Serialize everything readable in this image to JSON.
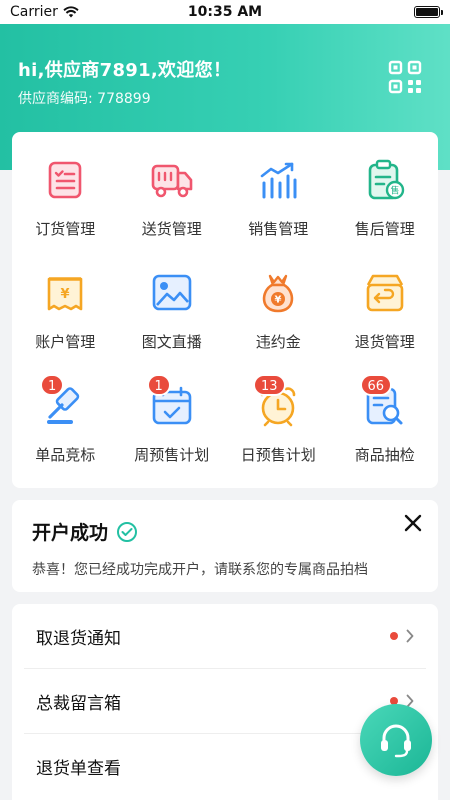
{
  "status_bar": {
    "carrier": "Carrier",
    "time": "10:35 AM"
  },
  "header": {
    "greeting": "hi,供应商7891,欢迎您！",
    "supplier_code": "供应商编码: 778899"
  },
  "menu": [
    {
      "label": "订货管理",
      "icon": "order-list-icon"
    },
    {
      "label": "送货管理",
      "icon": "delivery-truck-icon"
    },
    {
      "label": "销售管理",
      "icon": "sales-chart-icon"
    },
    {
      "label": "售后管理",
      "icon": "after-sales-clipboard-icon"
    },
    {
      "label": "账户管理",
      "icon": "account-receipt-icon"
    },
    {
      "label": "图文直播",
      "icon": "image-live-icon"
    },
    {
      "label": "违约金",
      "icon": "penalty-money-bag-icon"
    },
    {
      "label": "退货管理",
      "icon": "return-box-icon"
    },
    {
      "label": "单品竞标",
      "icon": "auction-gavel-icon",
      "badge": "1"
    },
    {
      "label": "周预售计划",
      "icon": "weekly-calendar-icon",
      "badge": "1"
    },
    {
      "label": "日预售计划",
      "icon": "alarm-clock-icon",
      "badge": "13"
    },
    {
      "label": "商品抽检",
      "icon": "inspection-search-icon",
      "badge": "66"
    }
  ],
  "notice": {
    "title": "开户成功",
    "text": "恭喜！您已经成功完成开户，请联系您的专属商品拍档"
  },
  "list": [
    {
      "label": "取退货通知",
      "dot": true
    },
    {
      "label": "总裁留言箱",
      "dot": true
    },
    {
      "label": "退货单查看",
      "dot": false
    }
  ],
  "colors": {
    "accent": "#23c0a3",
    "badge": "#e94b3c"
  }
}
